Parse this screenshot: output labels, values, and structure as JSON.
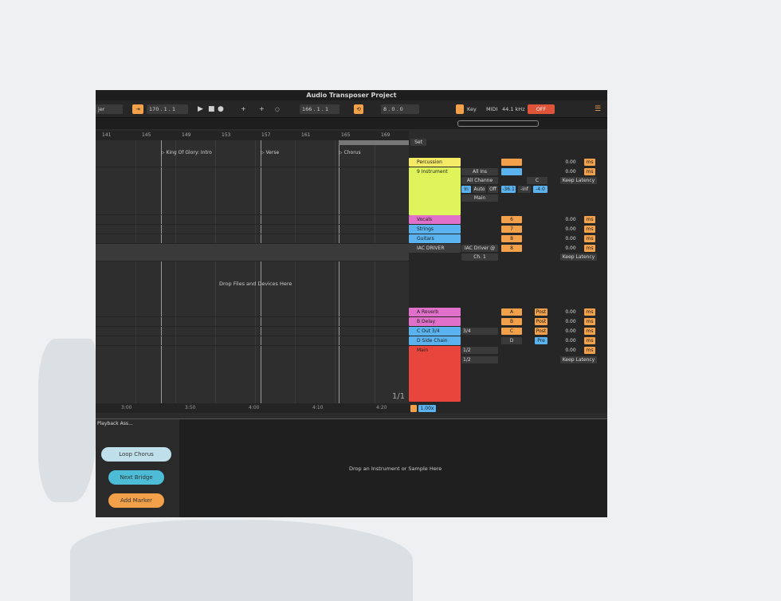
{
  "window": {
    "title": "Audio Transposer Project"
  },
  "toolbar": {
    "left_select": "jer",
    "position": "170 . 1 . 1",
    "loop_position": "166 . 1 . 1",
    "loop_length": "8 . 0 . 0",
    "key_label": "Key",
    "midi_label": "MIDI",
    "sample_rate": "44.1 kHz",
    "off_label": "OFF"
  },
  "ruler": [
    "141",
    "145",
    "149",
    "153",
    "157",
    "161",
    "165",
    "169"
  ],
  "markers": [
    {
      "label": "King Of Glory: Intro"
    },
    {
      "label": "Verse"
    },
    {
      "label": "Chorus"
    }
  ],
  "bottom_ruler": [
    "3:00",
    "3:50",
    "4:00",
    "4:10",
    "4:20"
  ],
  "page_indicator": "1/1",
  "drop_files_text": "Drop Files and Devices Here",
  "set_label": "Set",
  "tracks": [
    {
      "name": "Percussion",
      "color": "#f4ea66",
      "vol": "",
      "out": "0.00",
      "unit": "ms"
    },
    {
      "name": "9 Instrument",
      "color": "#dff35a",
      "vol": "",
      "out": "0.00",
      "unit": "ms"
    },
    {
      "name": "Vocals",
      "color": "#e070c9",
      "vol": "6",
      "out": "0.00",
      "unit": "ms"
    },
    {
      "name": "Strings",
      "color": "#5ab3ef",
      "vol": "7",
      "out": "0.00",
      "unit": "ms"
    },
    {
      "name": "Guitars",
      "color": "#5ab3ef",
      "vol": "8",
      "out": "0.00",
      "unit": "ms"
    },
    {
      "name": "IAC DRIVER",
      "color": "#3c3c3c",
      "vol": "8",
      "out": "0.00",
      "unit": "ms"
    },
    {
      "name": "A Reverb",
      "color": "#e070c9",
      "vol": "A",
      "out": "0.00",
      "unit": "ms"
    },
    {
      "name": "B Delay",
      "color": "#e070c9",
      "vol": "B",
      "out": "0.00",
      "unit": "ms"
    },
    {
      "name": "C Out 3/4",
      "color": "#5ab3ef",
      "vol": "C",
      "out": "0.00",
      "unit": "ms"
    },
    {
      "name": "D Side Chain",
      "color": "#5ab3ef",
      "vol": "D",
      "out": "0.00",
      "unit": "ms"
    },
    {
      "name": "Main",
      "color": "#e8453c",
      "vol": "",
      "out": "0.00",
      "unit": "ms"
    }
  ],
  "instrument_routing": {
    "all_ins": "All Ins",
    "all_channels": "All Channe",
    "in_label": "In",
    "auto_label": "Auto",
    "off_label": "Off",
    "main_label": "Main",
    "vol": "-36.1",
    "inf": "-inf",
    "pan": "-4.0",
    "c_label": "C"
  },
  "iac": {
    "driver": "IAC Driver @",
    "channel": "Ch. 1"
  },
  "returns": {
    "post": "Post",
    "pre": "Pre",
    "out34": "3/4",
    "out12": "1/2",
    "out12b": "1/2"
  },
  "keep_latency": "Keep Latency",
  "zoom_value": "1.00x",
  "device_panel": {
    "title": "Playback Ass...",
    "buttons": [
      {
        "label": "Loop Chorus",
        "color": "#bfe0ea"
      },
      {
        "label": "Next Bridge",
        "color": "#4dbcd6"
      },
      {
        "label": "Add Marker",
        "color": "#f2a14a"
      }
    ],
    "drop_instrument": "Drop an Instrument or Sample Here"
  }
}
